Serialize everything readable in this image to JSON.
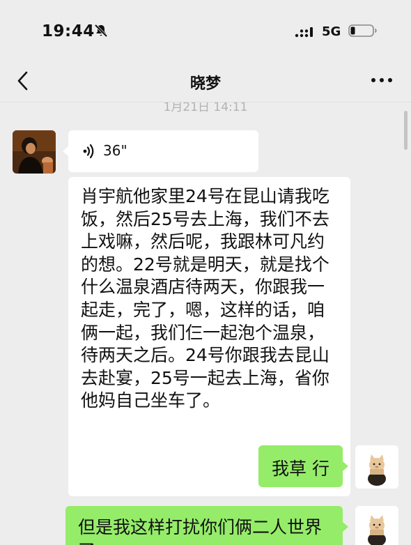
{
  "status_bar": {
    "time": "19:44",
    "network": "5G",
    "icons": [
      "bell-muted-icon",
      "signal-icon",
      "battery-icon"
    ]
  },
  "nav": {
    "title": "晓梦",
    "icons": [
      "back-chevron-icon",
      "more-icon"
    ]
  },
  "chat": {
    "timestamp": "1月21日 14:11",
    "messages": [
      {
        "sender": "other",
        "type": "voice",
        "duration": "36\""
      },
      {
        "sender": "other",
        "type": "text",
        "text": "肖宇航他家里24号在昆山请我吃饭，然后25号去上海，我们不去上戏嘛，然后呢，我跟林可凡约的想。22号就是明天，就是找个什么温泉酒店待两天，你跟我一起走，完了，嗯，这样的话，咱俩一起，我们仨一起泡个温泉，待两天之后。24号你跟我去昆山去赴宴，25号一起去上海，省你他妈自己坐车了。"
      },
      {
        "sender": "me",
        "type": "text",
        "text": "我草 行"
      },
      {
        "sender": "me",
        "type": "text",
        "text": "但是我这样打扰你们俩二人世界了"
      }
    ]
  },
  "colors": {
    "background": "#ededed",
    "my_bubble": "#95ec69",
    "other_bubble": "#ffffff"
  }
}
